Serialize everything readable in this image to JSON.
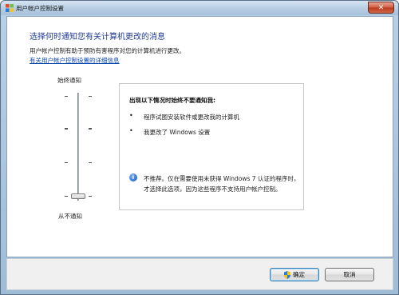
{
  "window": {
    "title": "用户帐户控制设置",
    "close_label": "✕"
  },
  "content": {
    "heading": "选择何时通知您有关计算机更改的消息",
    "description": "用户帐户控制有助于预防有害程序对您的计算机进行更改。",
    "link": "有关用户帐户控制设置的详细信息"
  },
  "slider": {
    "top_label": "始终通知",
    "bottom_label": "从不通知",
    "level": 0,
    "levels": 4
  },
  "panel": {
    "title": "出现以下情况时始终不要通知我:",
    "bullets": [
      "程序试图安装软件或更改我的计算机",
      "我更改了 Windows 设置"
    ],
    "note": "不推荐。仅在需要使用未获得 Windows 7 认证的程序时，才选择此选项，因为这些程序不支持用户帐户控制。"
  },
  "buttons": {
    "ok": "确定",
    "cancel": "取消"
  }
}
